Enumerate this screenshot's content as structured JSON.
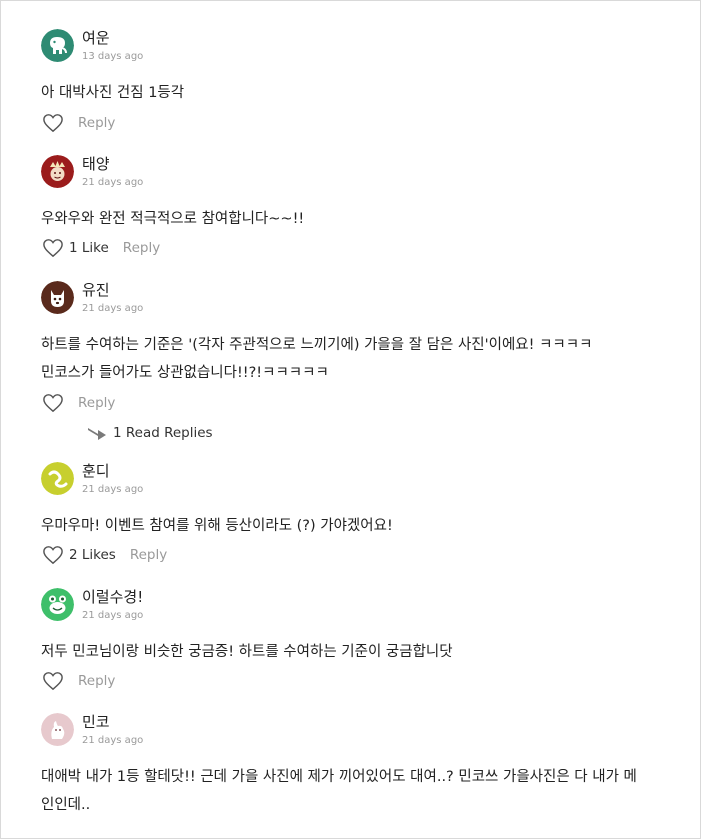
{
  "comments": [
    {
      "author": "여운",
      "date": "13 days ago",
      "lines": [
        "아 대박사진 건짐 1등각"
      ],
      "likes": "",
      "reply_label": "Reply",
      "avatar": {
        "icon": "elephant-avatar-icon",
        "bg": "#2e8b73"
      }
    },
    {
      "author": "태양",
      "date": "21 days ago",
      "lines": [
        "우와우와 완전 적극적으로 참여합니다~~!!"
      ],
      "likes": "1 Like",
      "reply_label": "Reply",
      "avatar": {
        "icon": "king-avatar-icon",
        "bg": "#9b1c1c"
      }
    },
    {
      "author": "유진",
      "date": "21 days ago",
      "lines": [
        "하트를 수여하는 기준은 '(각자 주관적으로 느끼기에) 가을을 잘 담은 사진'이에요! ㅋㅋㅋㅋ",
        "민코스가 들어가도 상관없습니다!!?!ㅋㅋㅋㅋㅋ"
      ],
      "likes": "",
      "reply_label": "Reply",
      "read_replies": "1 Read Replies",
      "avatar": {
        "icon": "dog-avatar-icon",
        "bg": "#5a2a1c"
      }
    },
    {
      "author": "훈디",
      "date": "21 days ago",
      "lines": [
        "우마우마! 이벤트 참여를 위해 등산이라도 (?) 가야겠어요!"
      ],
      "likes": "2 Likes",
      "reply_label": "Reply",
      "avatar": {
        "icon": "squiggle-avatar-icon",
        "bg": "#c7cf2e"
      }
    },
    {
      "author": "이럴수경!",
      "date": "21 days ago",
      "lines": [
        "저두 민코님이랑 비슷한 궁금증! 하트를 수여하는 기준이 궁금합니닷"
      ],
      "likes": "",
      "reply_label": "Reply",
      "avatar": {
        "icon": "frog-avatar-icon",
        "bg": "#3ebf6a"
      }
    },
    {
      "author": "민코",
      "date": "21 days ago",
      "lines": [
        "대애박 내가 1등 할테닷!! 근데 가을 사진에 제가 끼어있어도 대여..? 민코쓰 가을사진은 다 내가 메",
        "인인데.."
      ],
      "avatar": {
        "icon": "pink-character-avatar-icon",
        "bg": "#e7c9cd"
      }
    }
  ],
  "colors": {
    "text": "#222222",
    "muted": "#9a9a9a",
    "border": "#d9d9d9",
    "heart_stroke": "#555555"
  }
}
